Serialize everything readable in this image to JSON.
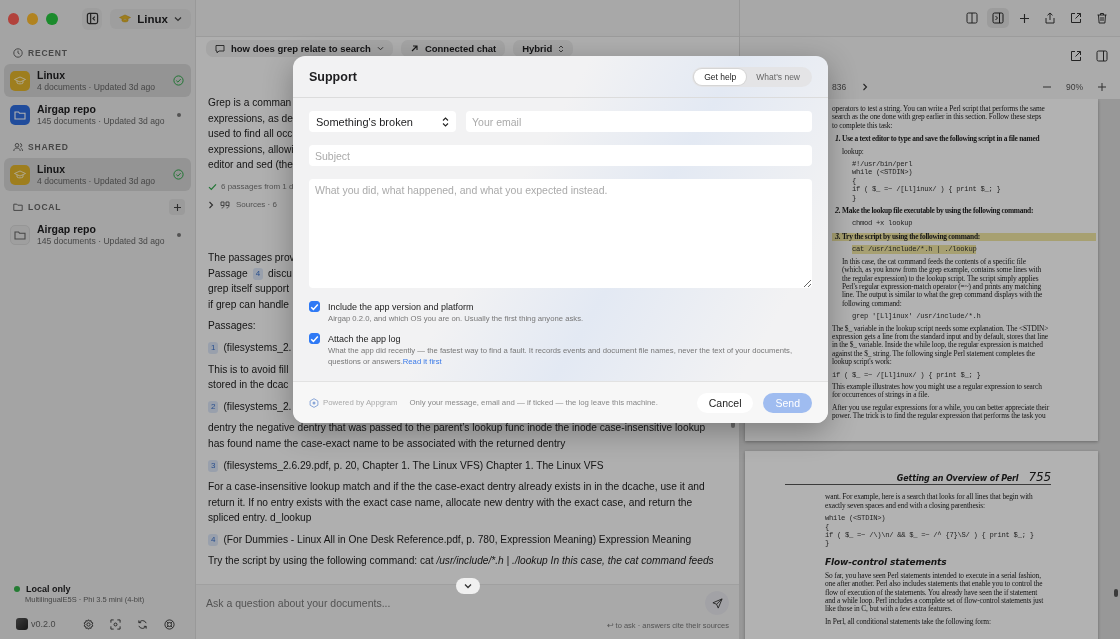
{
  "titlebar": {
    "workspace": "Linux"
  },
  "sidebar": {
    "sections": [
      {
        "title": "RECENT",
        "addable": false,
        "items": [
          {
            "name": "Linux",
            "meta": "4 documents · Updated 3d ago",
            "kind": "collection",
            "selected": true,
            "synced": true
          },
          {
            "name": "Airgap repo",
            "meta": "145 documents · Updated 3d ago",
            "kind": "folder",
            "selected": false,
            "synced": false
          }
        ]
      },
      {
        "title": "SHARED",
        "addable": false,
        "items": [
          {
            "name": "Linux",
            "meta": "4 documents · Updated 3d ago",
            "kind": "collection",
            "selected": true,
            "synced": true
          }
        ]
      },
      {
        "title": "LOCAL",
        "addable": true,
        "items": [
          {
            "name": "Airgap repo",
            "meta": "145 documents · Updated 3d ago",
            "kind": "local",
            "selected": false,
            "synced": false
          }
        ]
      }
    ],
    "status": {
      "label": "Local only",
      "models": "MultilingualE5S · Phi 3.5 mini (4-bit)"
    },
    "version": "v0.2.0"
  },
  "chat": {
    "chips": [
      {
        "kind": "conversation",
        "label": "how does grep relate to search"
      },
      {
        "kind": "link",
        "label": "Connected chat"
      },
      {
        "kind": "mode",
        "label": "Hybrid"
      }
    ],
    "blocks": [
      {
        "kind": "lines",
        "lines": [
          {
            "text": "Grep is a comman"
          },
          {
            "text": "expressions, as de"
          },
          {
            "text": "used to find all occ"
          },
          {
            "text": "expressions, allowi"
          },
          {
            "text": "editor and sed (the"
          }
        ]
      },
      {
        "kind": "status",
        "text": "6 passages from 1 d"
      },
      {
        "kind": "sources",
        "label": "Sources",
        "count": "· 6"
      },
      {
        "kind": "lines",
        "lines": [
          {
            "text": "The passages prov"
          },
          {
            "text": "Passage",
            "cite": "4",
            "after": "discu"
          },
          {
            "text": "grep itself support"
          },
          {
            "text": "if grep can handle"
          }
        ]
      },
      {
        "kind": "lines",
        "lines": [
          {
            "text": "Passages:"
          }
        ]
      },
      {
        "kind": "cite",
        "number": "1",
        "text": "(filesystems_2."
      },
      {
        "kind": "lines",
        "lines": [
          {
            "text": "This is to avoid fill"
          },
          {
            "text": "stored in the dcac"
          }
        ]
      },
      {
        "kind": "cite",
        "number": "2",
        "text": "(filesystems_2."
      },
      {
        "kind": "lines",
        "lines": [
          {
            "text": "dentry the negative dentry that was passed to the parent’s lookup func inode the inode case-insensitive lookup"
          },
          {
            "text": "has found name the case-exact name to be associated with the returned dentry"
          }
        ]
      },
      {
        "kind": "cite",
        "number": "3",
        "text": "(filesystems_2.6.29.pdf, p. 20, Chapter 1. The Linux VFS) Chapter 1. The Linux VFS"
      },
      {
        "kind": "lines",
        "lines": [
          {
            "text": "For a case-insensitive lookup match and if the the case-exact dentry already exists in in the dcache, use it and"
          },
          {
            "text": "return it. If no entry exists with the exact case name, allocate new dentry with the exact case, and return the"
          },
          {
            "text": "spliced entry. d_lookup"
          }
        ]
      },
      {
        "kind": "cite",
        "number": "4",
        "text": "(For Dummies - Linux All in One Desk Reference.pdf, p. 780, Expression Meaning) Expression Meaning"
      },
      {
        "kind": "lines",
        "lines": [
          {
            "text": "Try the script by using the following command: cat ",
            "emph": "/usr/include/*.h | ./lookup In this case, the cat command feeds"
          }
        ]
      }
    ],
    "composer": {
      "placeholder": "Ask a question about your documents...",
      "hint": "↩ to ask · answers cite their sources"
    }
  },
  "pdf": {
    "page_indicator": "836",
    "zoom": "90%",
    "pages": [
      {
        "blocks": [
          {
            "kind": "text",
            "lines": [
              "operators to test a string. You can write a Perl script that performs the same",
              "search as the one done with grep earlier in this section. Follow these steps",
              "to complete this task:"
            ]
          },
          {
            "kind": "step",
            "number": "1.",
            "lines": [
              "Use a text editor to type and save the following script in a file named"
            ],
            "highlighted": false
          },
          {
            "kind": "step-text",
            "lines": [
              "lookup:"
            ]
          },
          {
            "kind": "step-code",
            "lines": [
              "#!/usr/bin/perl",
              "while (<STDIN>)",
              "{",
              "    if ( $_ =~ /[Ll]inux/ ) { print $_; }",
              "}"
            ],
            "highlighted": false
          },
          {
            "kind": "step",
            "number": "2.",
            "lines": [
              "Make the lookup file executable by using the following command:"
            ],
            "highlighted": false
          },
          {
            "kind": "step-code",
            "lines": [
              "chmod +x lookup"
            ],
            "highlighted": false
          },
          {
            "kind": "step",
            "number": "3.",
            "lines": [
              "Try the script by using the following command:"
            ],
            "highlighted": true
          },
          {
            "kind": "step-code",
            "lines": [
              "cat /usr/include/*.h | ./lookup"
            ],
            "highlighted": true
          },
          {
            "kind": "step-text",
            "lines": [
              "In this case, the cat command feeds the contents of a specific file",
              "(which, as you know from the grep example, contains some lines with",
              "the regular expression) to the lookup script. The script simply applies",
              "Perl's regular expression-match operator (=~) and prints any matching",
              "line. The output is similar to what the grep command displays with the",
              "following command:"
            ]
          },
          {
            "kind": "step-code",
            "lines": [
              "grep '[Ll]inux' /usr/include/*.h"
            ],
            "highlighted": false
          },
          {
            "kind": "text",
            "lines": [
              "The $_ variable in the lookup script needs some explanation. The <STDIN>",
              "expression gets a line from the standard input and by default, stores that line",
              "in the $_ variable. Inside the while loop, the regular expression is matched",
              "against the $_ string. The following single Perl statement completes the",
              "lookup script's work:"
            ]
          },
          {
            "kind": "code",
            "lines": [
              "if ( $_ =~ /[Ll]inux/ ) { print $_; }"
            ],
            "highlighted": false
          },
          {
            "kind": "text",
            "lines": [
              "This example illustrates how you might use a regular expression to search",
              "for occurrences of strings in a file."
            ]
          },
          {
            "kind": "text",
            "lines": [
              "After you use regular expressions for a while, you can better appreciate their",
              "power. The trick is to find the regular expression that performs the task you"
            ]
          }
        ]
      },
      {
        "blocks": [
          {
            "kind": "running-head",
            "text": "Getting an Overview of Perl",
            "page": "755"
          },
          {
            "kind": "text",
            "lines": [
              "want. For example, here is a search that looks for all lines that begin with",
              "exactly seven spaces and end with a closing parenthesis:"
            ]
          },
          {
            "kind": "code",
            "lines": [
              "while (<STDIN>)",
              "{",
              "    if ( $_ =~ /\\)\\n/ && $_ =~ /^ {7}\\S/ )  { print $_; }",
              "}"
            ],
            "highlighted": false
          },
          {
            "kind": "heading",
            "text": "Flow-control statements"
          },
          {
            "kind": "text",
            "lines": [
              "So far, you have seen Perl statements intended to execute in a serial fashion,",
              "one after another. Perl also includes statements that enable you to control the",
              "flow of execution of the statements. You already have seen the if statement",
              "and a while loop. Perl includes a complete set of flow-control statements just",
              "like those in C, but with a few extra features."
            ]
          },
          {
            "kind": "text",
            "lines": [
              "In Perl, all conditional statements take the following form:"
            ]
          }
        ]
      }
    ]
  },
  "modal": {
    "title": "Support",
    "tabs": [
      {
        "label": "Get help",
        "selected": true
      },
      {
        "label": "What's new",
        "selected": false
      }
    ],
    "category": "Something's broken",
    "email": {
      "placeholder": "Your email"
    },
    "subject": {
      "placeholder": "Subject"
    },
    "message": {
      "placeholder": "What you did, what happened, and what you expected instead."
    },
    "options": [
      {
        "label": "Include the app version and platform",
        "description": "Airgap 0.2.0, and which OS you are on. Usually the first thing anyone asks.",
        "checked": true
      },
      {
        "label": "Attach the app log",
        "description": "What the app did recently — the fastest way to find a fault. It records events and document file names, never the text of your documents, questions or answers.",
        "link": "Read it first",
        "checked": true
      }
    ],
    "footer": {
      "brand": "Powered by Appgram",
      "note": "Only your message, email and — if ticked — the log leave this machine."
    },
    "buttons": [
      {
        "label": "Cancel",
        "kind": "secondary",
        "disabled": false
      },
      {
        "label": "Send",
        "kind": "primary",
        "disabled": true
      }
    ]
  }
}
